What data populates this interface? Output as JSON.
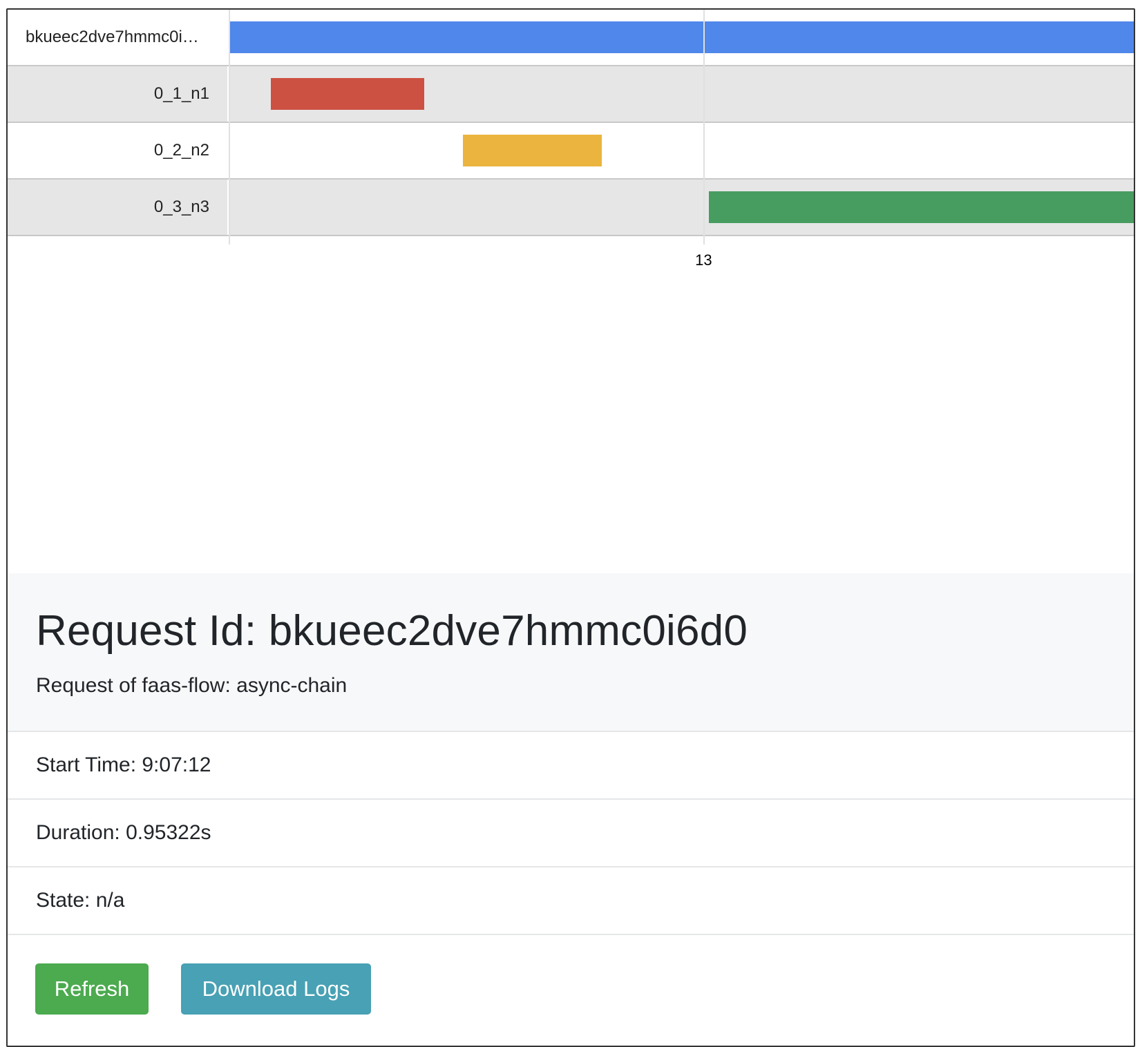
{
  "timeline": {
    "rows": [
      {
        "label": "bkueec2dve7hmmc0i…",
        "color": "#4f87ea",
        "start": 0.0,
        "end": 1.0
      },
      {
        "label": "0_1_n1",
        "color": "#cd5142",
        "start": 0.045,
        "end": 0.215
      },
      {
        "label": "0_2_n2",
        "color": "#ebb43e",
        "start": 0.258,
        "end": 0.411
      },
      {
        "label": "0_3_n3",
        "color": "#479c5f",
        "start": 0.53,
        "end": 1.0
      }
    ],
    "ticks": [
      {
        "label": "13",
        "at": 0.524
      }
    ]
  },
  "request": {
    "title": "Request Id: bkueec2dve7hmmc0i6d0",
    "subtitle": "Request of faas-flow: async-chain",
    "start_time": "Start Time: 9:07:12",
    "duration": "Duration: 0.95322s",
    "state": "State: n/a"
  },
  "buttons": {
    "refresh": "Refresh",
    "download_logs": "Download Logs"
  }
}
